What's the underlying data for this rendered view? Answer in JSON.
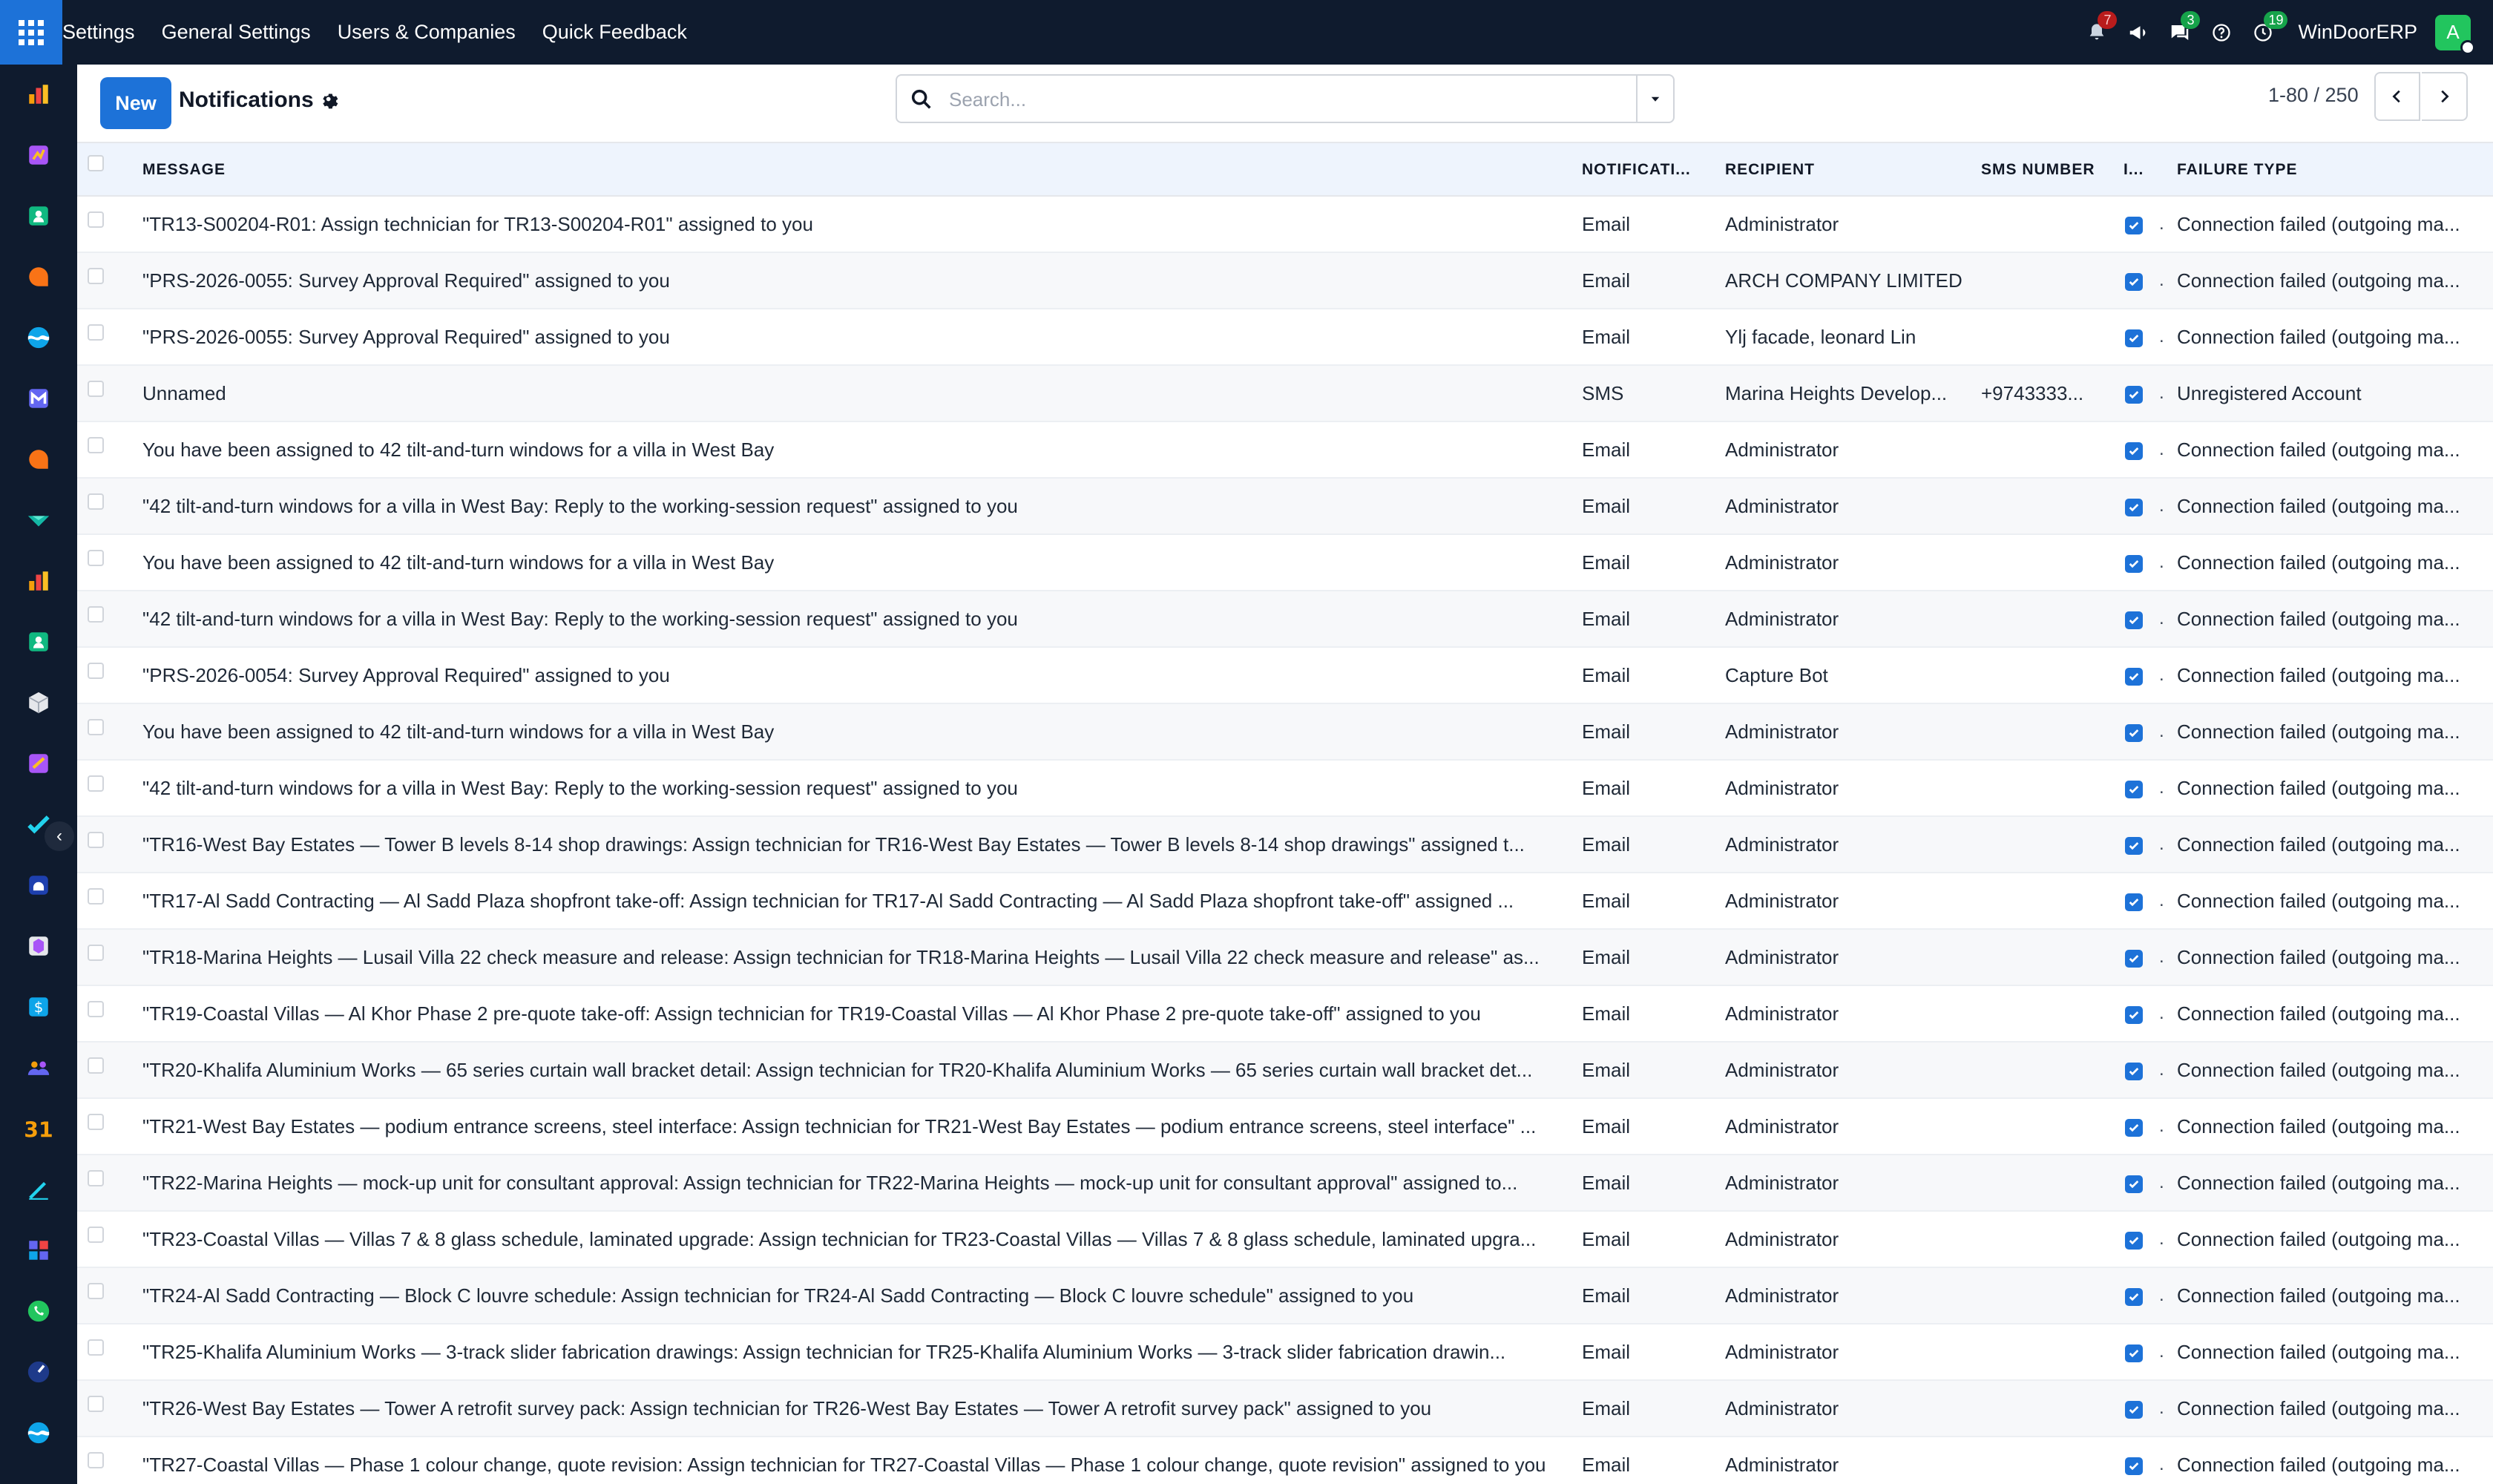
{
  "navbar": {
    "menu": [
      "Settings",
      "General Settings",
      "Users & Companies",
      "Quick Feedback"
    ],
    "badges": {
      "activity": "7",
      "messages": "3",
      "timer": "19"
    },
    "company": "WinDoorERP",
    "avatar_letter": "A",
    "colors": {
      "bar": "#0f1b2e",
      "apps": "#1d72d8",
      "avatar": "#22c55e"
    }
  },
  "sidebar": {
    "icons": [
      "chart-bars-icon",
      "dashboard-tile-icon",
      "contacts-icon",
      "discuss-bubble-icon",
      "website-wave-icon",
      "email-marketing-icon",
      "chat-bubble-icon",
      "inventory-diamond-icon",
      "reporting-icon",
      "employees-icon",
      "cube-icon",
      "documents-icon",
      "project-check-icon",
      "helpdesk-icon",
      "package-icon",
      "sales-dollar-icon",
      "team-icon",
      "calendar-31-icon",
      "sign-pen-icon",
      "apps-grid-icon",
      "whatsapp-icon",
      "dial-icon",
      "wave-icon"
    ]
  },
  "control": {
    "new_label": "New",
    "title": "Notifications",
    "search_placeholder": "Search...",
    "pager": "1-80 / 250"
  },
  "table": {
    "columns": {
      "message": "MESSAGE",
      "notification_type": "NOTIFICATI...",
      "recipient": "RECIPIENT",
      "sms_number": "SMS NUMBER",
      "flag": "I...",
      "failure_type": "FAILURE TYPE"
    },
    "rows": [
      {
        "message": "\"TR13-S00204-R01: Assign technician for TR13-S00204-R01\" assigned to you",
        "type": "Email",
        "recipient": "Administrator",
        "sms": "",
        "failure": "Connection failed (outgoing ma..."
      },
      {
        "message": "\"PRS-2026-0055: Survey Approval Required\" assigned to you",
        "type": "Email",
        "recipient": "ARCH COMPANY LIMITED",
        "sms": "",
        "failure": "Connection failed (outgoing ma..."
      },
      {
        "message": "\"PRS-2026-0055: Survey Approval Required\" assigned to you",
        "type": "Email",
        "recipient": "Ylj facade, leonard Lin",
        "sms": "",
        "failure": "Connection failed (outgoing ma..."
      },
      {
        "message": "Unnamed",
        "type": "SMS",
        "recipient": "Marina Heights Develop...",
        "sms": "+9743333...",
        "failure": "Unregistered Account"
      },
      {
        "message": "You have been assigned to 42 tilt-and-turn windows for a villa in West Bay",
        "type": "Email",
        "recipient": "Administrator",
        "sms": "",
        "failure": "Connection failed (outgoing ma..."
      },
      {
        "message": "\"42 tilt-and-turn windows for a villa in West Bay: Reply to the working-session request\" assigned to you",
        "type": "Email",
        "recipient": "Administrator",
        "sms": "",
        "failure": "Connection failed (outgoing ma..."
      },
      {
        "message": "You have been assigned to 42 tilt-and-turn windows for a villa in West Bay",
        "type": "Email",
        "recipient": "Administrator",
        "sms": "",
        "failure": "Connection failed (outgoing ma..."
      },
      {
        "message": "\"42 tilt-and-turn windows for a villa in West Bay: Reply to the working-session request\" assigned to you",
        "type": "Email",
        "recipient": "Administrator",
        "sms": "",
        "failure": "Connection failed (outgoing ma..."
      },
      {
        "message": "\"PRS-2026-0054: Survey Approval Required\" assigned to you",
        "type": "Email",
        "recipient": "Capture Bot",
        "sms": "",
        "failure": "Connection failed (outgoing ma..."
      },
      {
        "message": "You have been assigned to 42 tilt-and-turn windows for a villa in West Bay",
        "type": "Email",
        "recipient": "Administrator",
        "sms": "",
        "failure": "Connection failed (outgoing ma..."
      },
      {
        "message": "\"42 tilt-and-turn windows for a villa in West Bay: Reply to the working-session request\" assigned to you",
        "type": "Email",
        "recipient": "Administrator",
        "sms": "",
        "failure": "Connection failed (outgoing ma..."
      },
      {
        "message": "\"TR16-West Bay Estates — Tower B levels 8-14 shop drawings: Assign technician for TR16-West Bay Estates — Tower B levels 8-14 shop drawings\" assigned t...",
        "type": "Email",
        "recipient": "Administrator",
        "sms": "",
        "failure": "Connection failed (outgoing ma..."
      },
      {
        "message": "\"TR17-Al Sadd Contracting — Al Sadd Plaza shopfront take-off: Assign technician for TR17-Al Sadd Contracting — Al Sadd Plaza shopfront take-off\" assigned ...",
        "type": "Email",
        "recipient": "Administrator",
        "sms": "",
        "failure": "Connection failed (outgoing ma..."
      },
      {
        "message": "\"TR18-Marina Heights — Lusail Villa 22 check measure and release: Assign technician for TR18-Marina Heights — Lusail Villa 22 check measure and release\" as...",
        "type": "Email",
        "recipient": "Administrator",
        "sms": "",
        "failure": "Connection failed (outgoing ma..."
      },
      {
        "message": "\"TR19-Coastal Villas — Al Khor Phase 2 pre-quote take-off: Assign technician for TR19-Coastal Villas — Al Khor Phase 2 pre-quote take-off\" assigned to you",
        "type": "Email",
        "recipient": "Administrator",
        "sms": "",
        "failure": "Connection failed (outgoing ma..."
      },
      {
        "message": "\"TR20-Khalifa Aluminium Works — 65 series curtain wall bracket detail: Assign technician for TR20-Khalifa Aluminium Works — 65 series curtain wall bracket det...",
        "type": "Email",
        "recipient": "Administrator",
        "sms": "",
        "failure": "Connection failed (outgoing ma..."
      },
      {
        "message": "\"TR21-West Bay Estates — podium entrance screens, steel interface: Assign technician for TR21-West Bay Estates — podium entrance screens, steel interface\" ...",
        "type": "Email",
        "recipient": "Administrator",
        "sms": "",
        "failure": "Connection failed (outgoing ma..."
      },
      {
        "message": "\"TR22-Marina Heights — mock-up unit for consultant approval: Assign technician for TR22-Marina Heights — mock-up unit for consultant approval\" assigned to...",
        "type": "Email",
        "recipient": "Administrator",
        "sms": "",
        "failure": "Connection failed (outgoing ma..."
      },
      {
        "message": "\"TR23-Coastal Villas — Villas 7 & 8 glass schedule, laminated upgrade: Assign technician for TR23-Coastal Villas — Villas 7 & 8 glass schedule, laminated upgra...",
        "type": "Email",
        "recipient": "Administrator",
        "sms": "",
        "failure": "Connection failed (outgoing ma..."
      },
      {
        "message": "\"TR24-Al Sadd Contracting — Block C louvre schedule: Assign technician for TR24-Al Sadd Contracting — Block C louvre schedule\" assigned to you",
        "type": "Email",
        "recipient": "Administrator",
        "sms": "",
        "failure": "Connection failed (outgoing ma..."
      },
      {
        "message": "\"TR25-Khalifa Aluminium Works — 3-track slider fabrication drawings: Assign technician for TR25-Khalifa Aluminium Works — 3-track slider fabrication drawin...",
        "type": "Email",
        "recipient": "Administrator",
        "sms": "",
        "failure": "Connection failed (outgoing ma..."
      },
      {
        "message": "\"TR26-West Bay Estates — Tower A retrofit survey pack: Assign technician for TR26-West Bay Estates — Tower A retrofit survey pack\" assigned to you",
        "type": "Email",
        "recipient": "Administrator",
        "sms": "",
        "failure": "Connection failed (outgoing ma..."
      },
      {
        "message": "\"TR27-Coastal Villas — Phase 1 colour change, quote revision: Assign technician for TR27-Coastal Villas — Phase 1 colour change, quote revision\" assigned to you",
        "type": "Email",
        "recipient": "Administrator",
        "sms": "",
        "failure": "Connection failed (outgoing ma..."
      }
    ]
  }
}
